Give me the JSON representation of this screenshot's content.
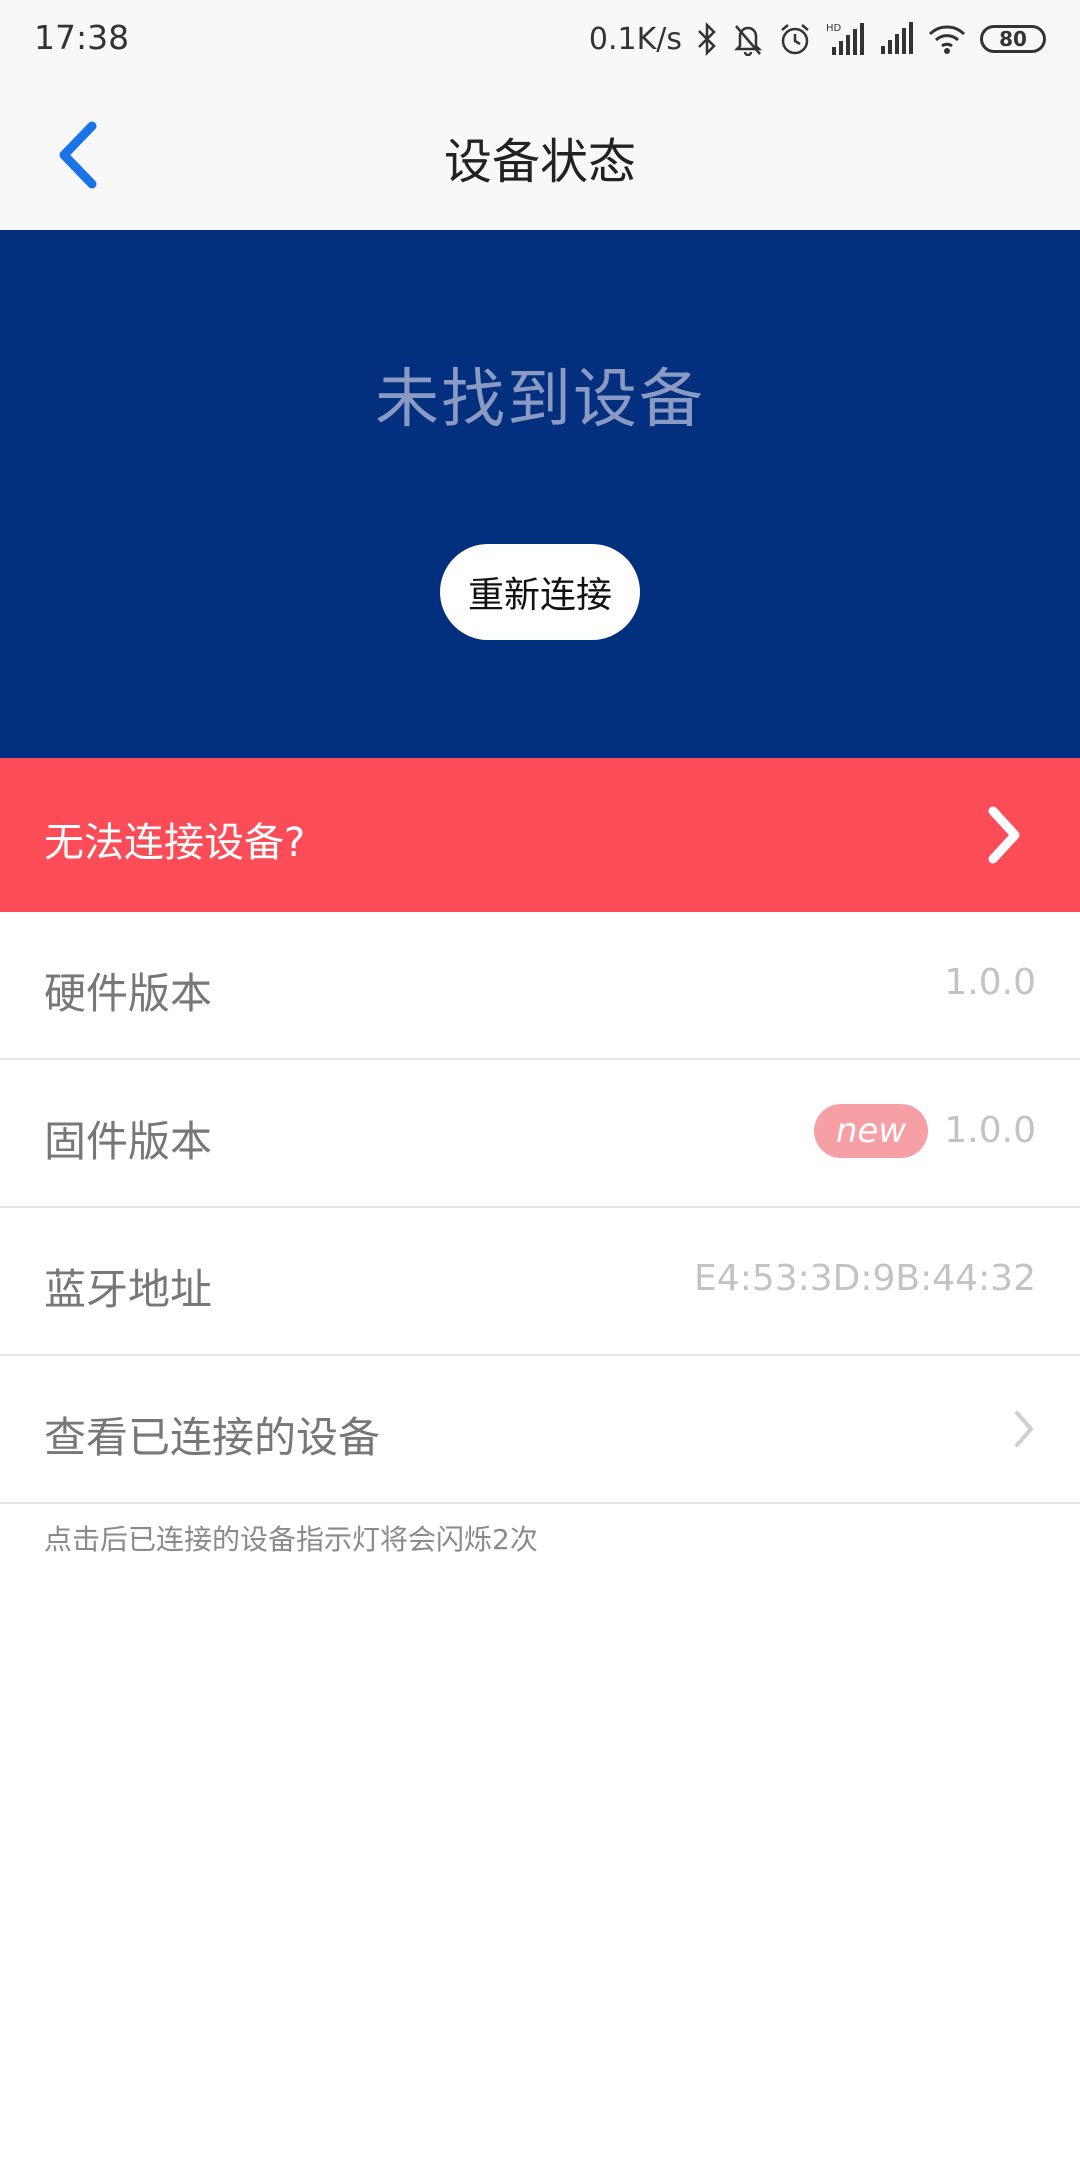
{
  "status_bar": {
    "time": "17:38",
    "network_speed": "0.1K/s",
    "battery": "80",
    "icons": [
      "bluetooth-icon",
      "bell-muted-icon",
      "alarm-icon",
      "signal-hd-icon",
      "signal-icon",
      "wifi-icon",
      "battery-icon"
    ]
  },
  "header": {
    "back_icon": "chevron-left-icon",
    "title": "设备状态"
  },
  "banner": {
    "status_text": "未找到设备",
    "reconnect_label": "重新连接",
    "background": "#02307e"
  },
  "help": {
    "label": "无法连接设备?",
    "chevron_icon": "chevron-right-icon",
    "background": "#fc4c58"
  },
  "info_rows": [
    {
      "label": "硬件版本",
      "value": "1.0.0"
    },
    {
      "label": "固件版本",
      "value": "1.0.0",
      "badge": "new"
    },
    {
      "label": "蓝牙地址",
      "value": "E4:53:3D:9B:44:32"
    },
    {
      "label": "查看已连接的设备",
      "chevron_icon": "chevron-right-icon"
    }
  ],
  "footnote": "点击后已连接的设备指示灯将会闪烁2次"
}
